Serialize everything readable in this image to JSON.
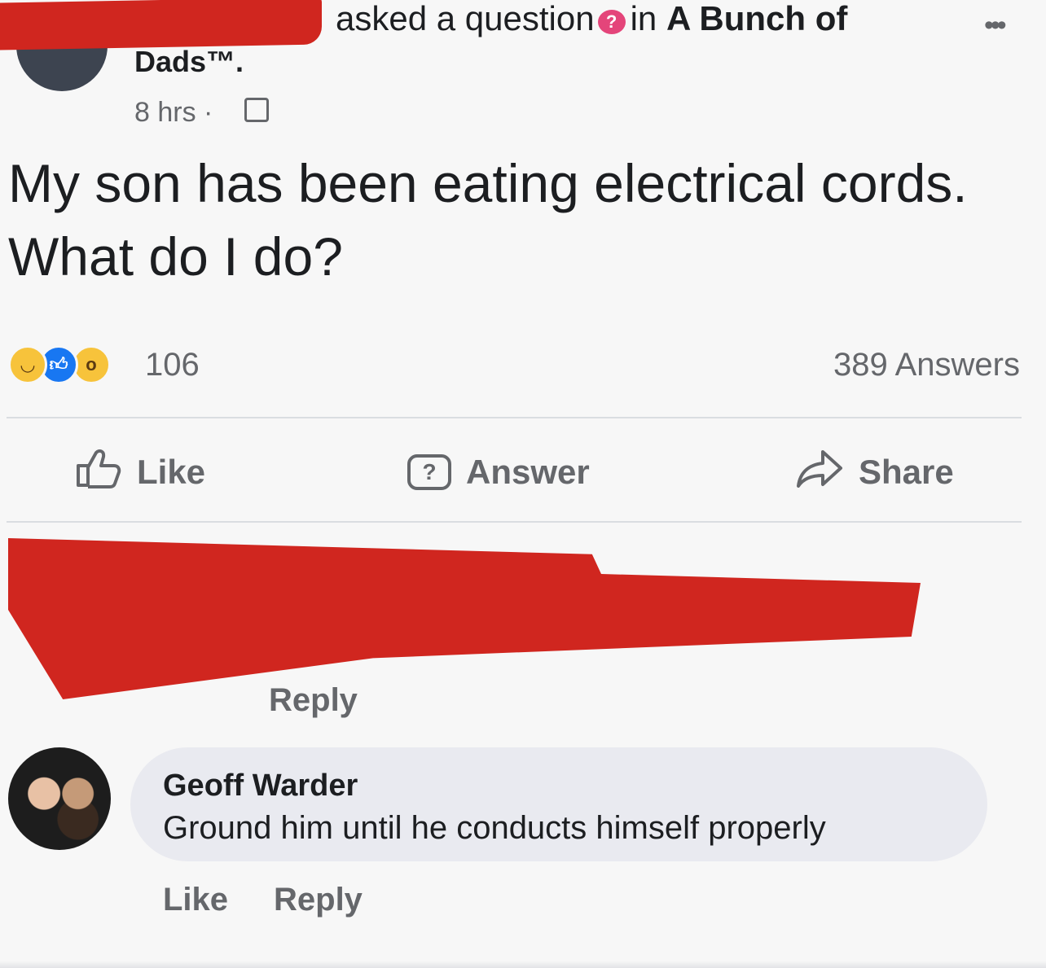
{
  "post": {
    "header_text": "asked a question",
    "question_badge": "?",
    "group_prefix": "in",
    "group_name": "A Bunch of",
    "group_name_cont": "Dads™.",
    "time": "8 hrs ·",
    "question": "My son has been eating electrical cords. What do I do?",
    "reaction_count": "106",
    "answer_count": "389 Answers"
  },
  "actions": {
    "like": "Like",
    "answer": "Answer",
    "share": "Share"
  },
  "redacted_comment": {
    "reply": "Reply"
  },
  "comment": {
    "author": "Geoff Warder",
    "text": "Ground him until he conducts himself properly",
    "like": "Like",
    "reply": "Reply"
  },
  "colors": {
    "redaction": "#d0261f",
    "secondary_text": "#65676b",
    "bubble": "#e9eaf0"
  },
  "icons": [
    "more-icon",
    "question-icon",
    "group-icon",
    "like-icon",
    "answer-icon",
    "share-icon",
    "haha-reaction-icon",
    "like-reaction-icon",
    "wow-reaction-icon"
  ]
}
